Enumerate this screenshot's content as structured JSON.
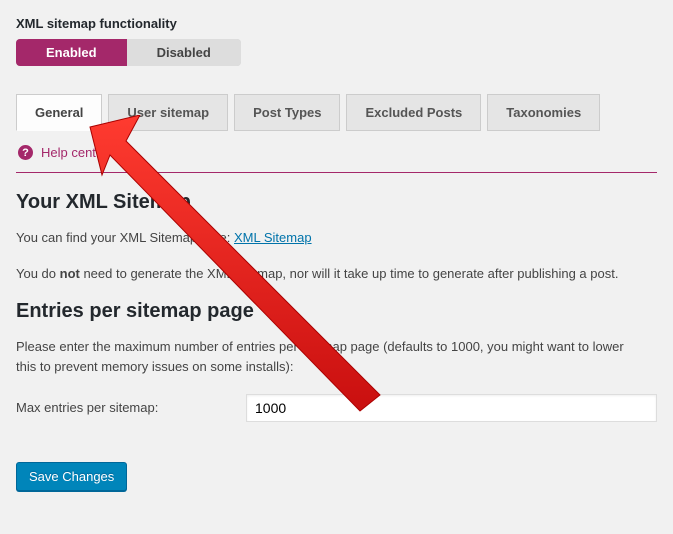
{
  "functionality": {
    "label": "XML sitemap functionality",
    "enabled_label": "Enabled",
    "disabled_label": "Disabled"
  },
  "tabs": [
    {
      "label": "General"
    },
    {
      "label": "User sitemap"
    },
    {
      "label": "Post Types"
    },
    {
      "label": "Excluded Posts"
    },
    {
      "label": "Taxonomies"
    }
  ],
  "help": {
    "label": "Help center"
  },
  "section1": {
    "heading": "Your XML Sitemap",
    "intro_prefix": "You can find your XML Sitemap here: ",
    "link_text": "XML Sitemap",
    "note_pre": "You do ",
    "note_strong": "not",
    "note_post": " need to generate the XML sitemap, nor will it take up time to generate after publishing a post."
  },
  "section2": {
    "heading": "Entries per sitemap page",
    "desc": "Please enter the maximum number of entries per sitemap page (defaults to 1000, you might want to lower this to prevent memory issues on some installs):",
    "field_label": "Max entries per sitemap:",
    "field_value": "1000"
  },
  "save": {
    "label": "Save Changes"
  }
}
